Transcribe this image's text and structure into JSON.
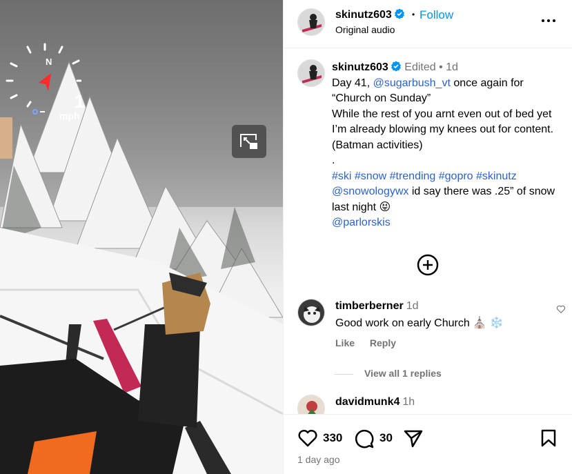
{
  "header": {
    "username": "skinutz603",
    "separator": "•",
    "follow_label": "Follow",
    "audio_label": "Original audio",
    "more_icon": "more-horizontal-icon"
  },
  "hud": {
    "compass_letter": "N",
    "speed": "1",
    "unit": "mph"
  },
  "caption": {
    "username": "skinutz603",
    "edited": "Edited",
    "separator": "•",
    "time": "1d",
    "line1_prefix": "Day 41, ",
    "line1_mention": "@sugarbush_vt",
    "line1_suffix": " once again for",
    "line2": "“Church on Sunday”",
    "line3": "While the rest of you arnt even out of bed yet I’m already blowing my knees out for content. (Batman activities)",
    "line4": ".",
    "hashtags": "#ski #snow #trending #gopro #skinutz",
    "mention2": "@snowologywx",
    "line5_suffix": " id say there was .25” of snow last night",
    "emoji": "😝",
    "mention3": "@parlorskis"
  },
  "load_more_icon": "plus-circle-icon",
  "comments": [
    {
      "username": "timberberner",
      "time": "1d",
      "text": "Good work on early Church",
      "emoji1": "⛪",
      "emoji2": "❄️",
      "like_label": "Like",
      "reply_label": "Reply"
    },
    {
      "username": "davidmunk4",
      "time": "1h"
    }
  ],
  "view_replies": "View all 1 replies",
  "footer": {
    "likes": "330",
    "comments": "30",
    "ago": "1 day ago"
  },
  "colors": {
    "link": "#2c63c9",
    "follow": "#0095f6",
    "muted": "#737373",
    "verified": "#0095f6"
  }
}
